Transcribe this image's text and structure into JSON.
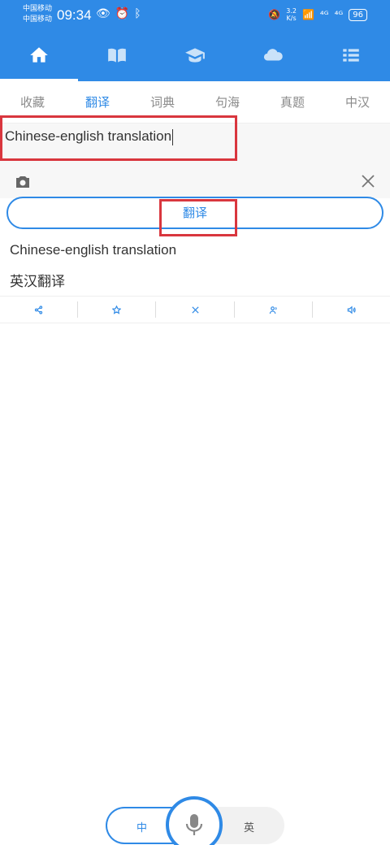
{
  "status_bar": {
    "carrier_1": "中国移动",
    "carrier_2": "中国移动",
    "time": "09:34",
    "net_speed_value": "3.2",
    "net_speed_unit": "K/s",
    "signal_1": "⁴ᴳ",
    "signal_2": "⁴ᴳ",
    "battery": "96"
  },
  "top_nav": {
    "items": [
      {
        "icon": "home-icon",
        "active": true
      },
      {
        "icon": "book-icon",
        "active": false
      },
      {
        "icon": "graduation-cap-icon",
        "active": false
      },
      {
        "icon": "cloud-icon",
        "active": false
      },
      {
        "icon": "list-icon",
        "active": false
      }
    ]
  },
  "sub_tabs": [
    "收藏",
    "翻译",
    "词典",
    "句海",
    "真题",
    "中汉"
  ],
  "active_sub_tab": "翻译",
  "input": {
    "value": "Chinese-english translation"
  },
  "translate_button": "翻译",
  "result": {
    "source": "Chinese-english translation",
    "translation": "英汉翻译"
  },
  "actions": [
    "share-icon",
    "star-icon",
    "close-icon",
    "speaker-person-icon",
    "volume-icon"
  ],
  "voice": {
    "left_lang": "中",
    "right_lang": "英"
  },
  "colors": {
    "primary": "#2f8ae6",
    "highlight": "#d9363e"
  }
}
